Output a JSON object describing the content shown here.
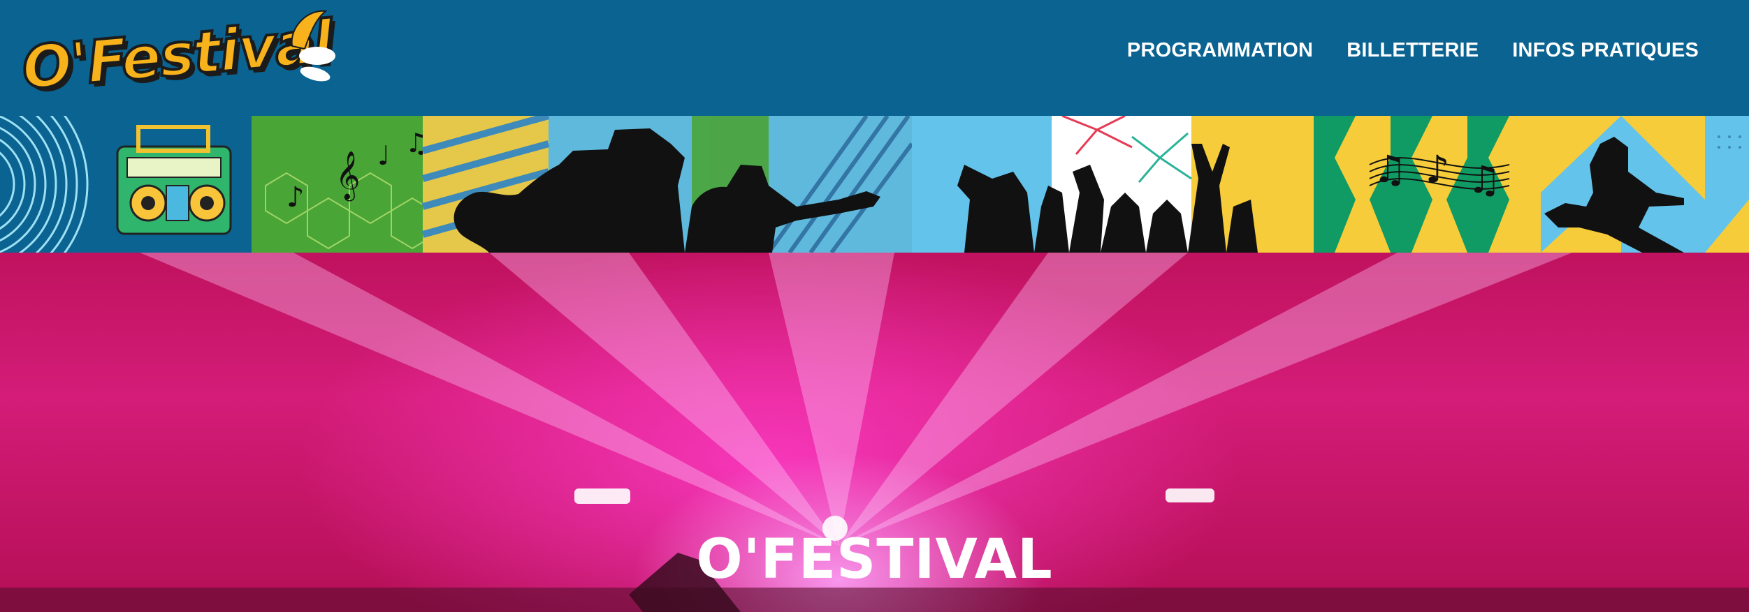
{
  "header": {
    "logo_text": "O'Festival",
    "nav": [
      {
        "label": "PROGRAMMATION"
      },
      {
        "label": "BILLETTERIE"
      },
      {
        "label": "INFOS PRATIQUES"
      }
    ]
  },
  "hero": {
    "title": "O'FESTIVAL"
  },
  "colors": {
    "header_bg": "#0a6390",
    "logo_yellow": "#f7b21c",
    "hero_pink": "#d41c78",
    "nav_text": "#ffffff"
  },
  "icons": [
    "boombox-icon",
    "saxophone-player-silhouette",
    "trumpet-player-silhouette",
    "dancing-crowd-silhouette",
    "guitarist-silhouette",
    "music-notes-icon",
    "fireworks-icon"
  ]
}
